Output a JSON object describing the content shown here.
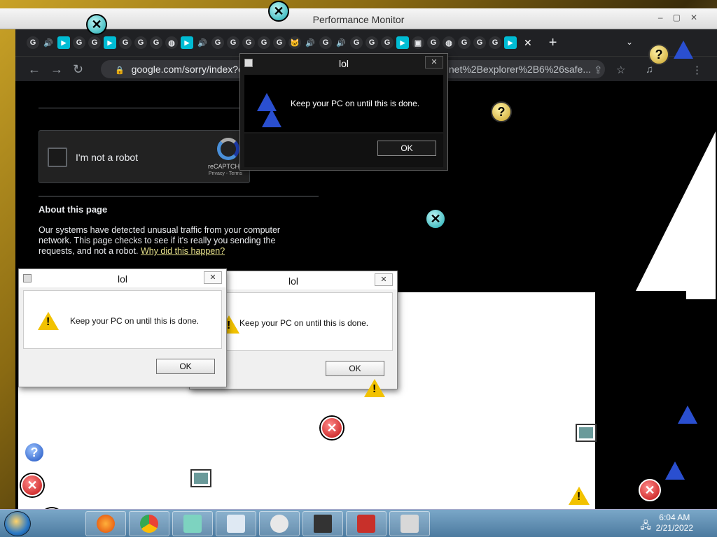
{
  "perf_monitor": {
    "title": "Performance Monitor",
    "controls": [
      "–",
      "▢",
      "✕"
    ]
  },
  "browser": {
    "tabs": [
      "G",
      "🔊",
      "▶",
      "G",
      "G",
      "▶",
      "G",
      "G",
      "G",
      "◍",
      "▶",
      "🔊",
      "G",
      "G",
      "G",
      "G",
      "G",
      "🐱",
      "🔊",
      "G",
      "🔊",
      "G",
      "G",
      "G",
      "▶",
      "▣",
      "G",
      "◍",
      "G",
      "G",
      "G",
      "▶"
    ],
    "tab_close": "✕",
    "new_tab": "+",
    "tab_menu": "⌄",
    "url": "google.com/sorry/index?co",
    "url_tail": "net%2Bexplorer%2B6%26safe...",
    "nav": {
      "back": "←",
      "forward": "→",
      "reload": "↻",
      "lock": "🔒",
      "share": "⇪",
      "star": "☆",
      "media": "♫",
      "menu": "⋮"
    }
  },
  "captcha": {
    "checkbox_label": "I'm not a robot",
    "brand": "reCAPTCHA",
    "links": "Privacy - Terms"
  },
  "about": {
    "title": "About this page",
    "body": "Our systems have detected unusual traffic from your computer network. This page checks to see if it's really you sending the requests, and not a robot.",
    "link": "Why did this happen?"
  },
  "dialogs": [
    {
      "title": "lol",
      "message": "Keep your PC on until this is done.",
      "ok": "OK",
      "close": "✕"
    },
    {
      "title": "lol",
      "message": "Keep your PC on until this is done.",
      "ok": "OK",
      "close": "✕"
    },
    {
      "title": "lol",
      "message": "Keep your PC on until this is done.",
      "ok": "OK",
      "close": "✕"
    }
  ],
  "taskbar": {
    "time": "6:04 AM",
    "date": "2/21/2022"
  },
  "icons": {
    "error": "✕",
    "teal_x": "✕",
    "question": "?",
    "info": "?",
    "warning": "!"
  }
}
